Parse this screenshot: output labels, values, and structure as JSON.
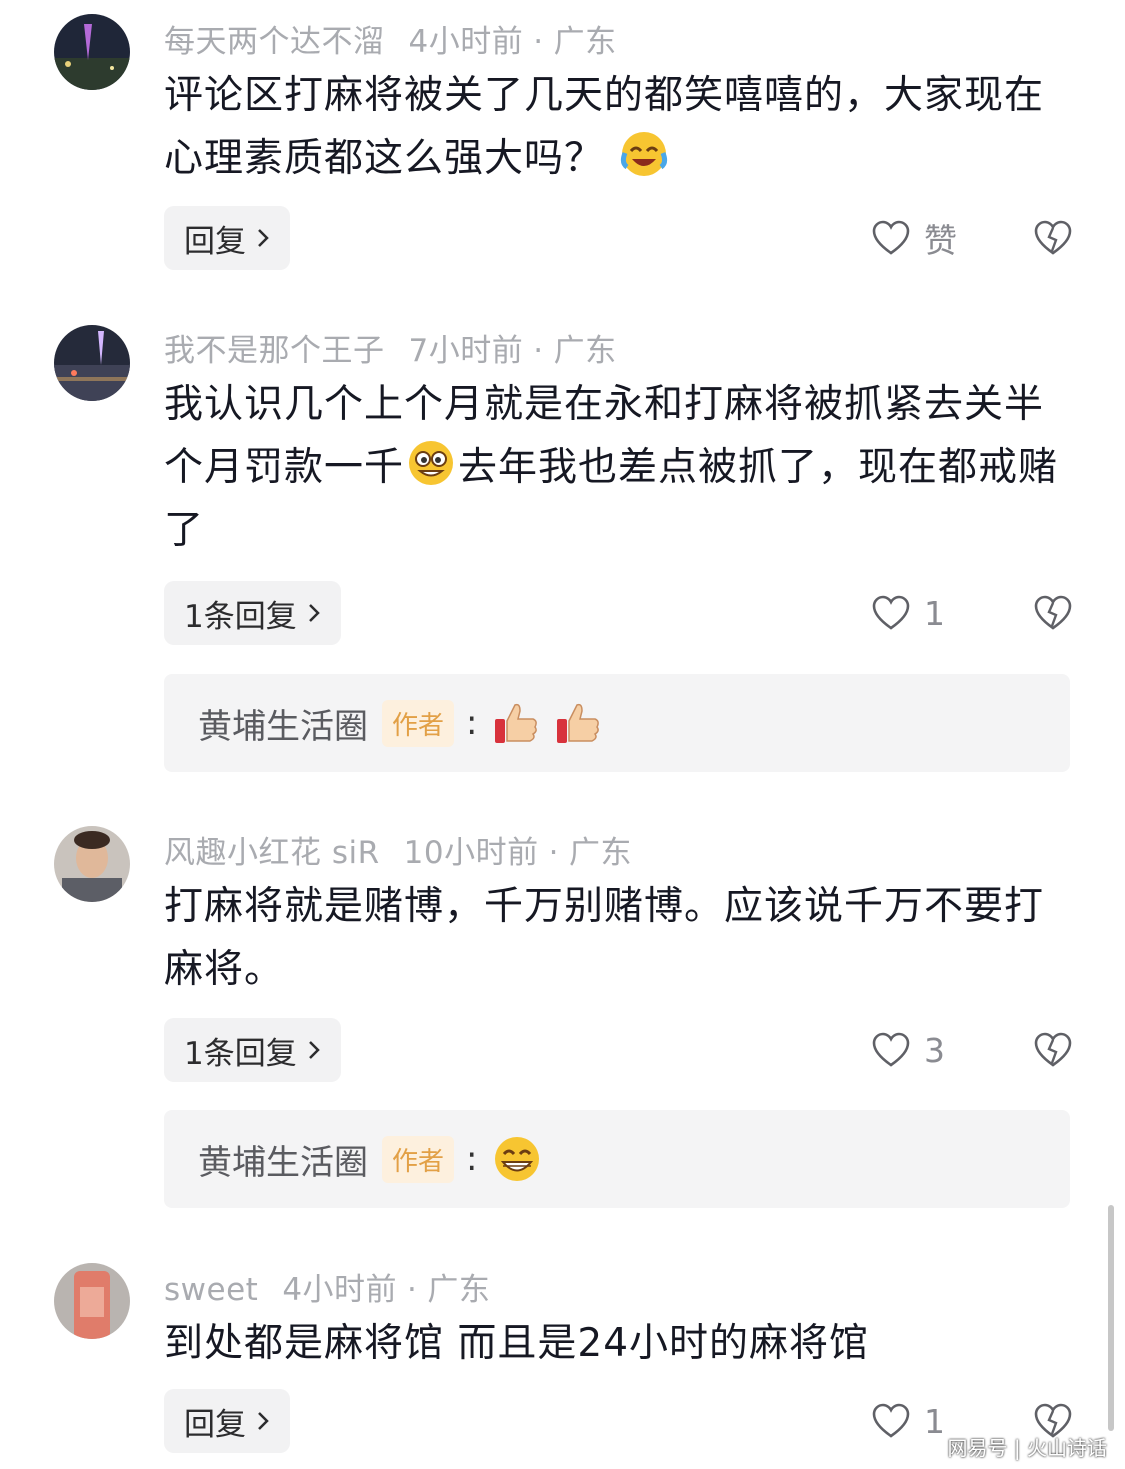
{
  "comments": [
    {
      "username": "每天两个达不溜",
      "time": "4小时前",
      "location": "广东",
      "text_parts": [
        "评论区打麻将被关了几天的都笑嘻嘻的，大家现在心理素质都这么强大吗？"
      ],
      "reply_label": "回复",
      "like_label": "赞",
      "avatar_color": "#2b3347"
    },
    {
      "username": "我不是那个王子",
      "time": "7小时前",
      "location": "广东",
      "text_parts": [
        "我认识几个上个月就是在永和打麻将被抓紧去关半个月罚款一千",
        "去年我也差点被抓了，现在都戒赌了"
      ],
      "reply_label": "1条回复",
      "like_count": "1",
      "author_reply": {
        "name": "黄埔生活圈",
        "badge": "作者",
        "colon": ":"
      },
      "avatar_color": "#3a3f4e"
    },
    {
      "username": "风趣小红花 siR",
      "time": "10小时前",
      "location": "广东",
      "text_parts": [
        "打麻将就是赌博，千万别赌博。应该说千万不要打麻将。"
      ],
      "reply_label": "1条回复",
      "like_count": "3",
      "author_reply": {
        "name": "黄埔生活圈",
        "badge": "作者",
        "colon": ":"
      },
      "avatar_color": "#b9a79a"
    },
    {
      "username": "sweet",
      "time": "4小时前",
      "location": "广东",
      "text_parts": [
        "到处都是麻将馆 而且是24小时的麻将馆"
      ],
      "reply_label": "回复",
      "like_count": "1",
      "avatar_color": "#c56a5a"
    }
  ],
  "separator": "·",
  "watermark": "网易号 | 火山诗话",
  "icons": {
    "emoji_laugh_cry": "laughing-crying-emoji-icon",
    "emoji_goofy": "goofy-face-emoji-icon",
    "emoji_thumbs": "thumbs-up-emoji-icon",
    "emoji_grin": "grinning-emoji-icon",
    "like": "heart-outline-icon",
    "dislike": "broken-heart-icon",
    "chevron": "chevron-right-icon"
  }
}
